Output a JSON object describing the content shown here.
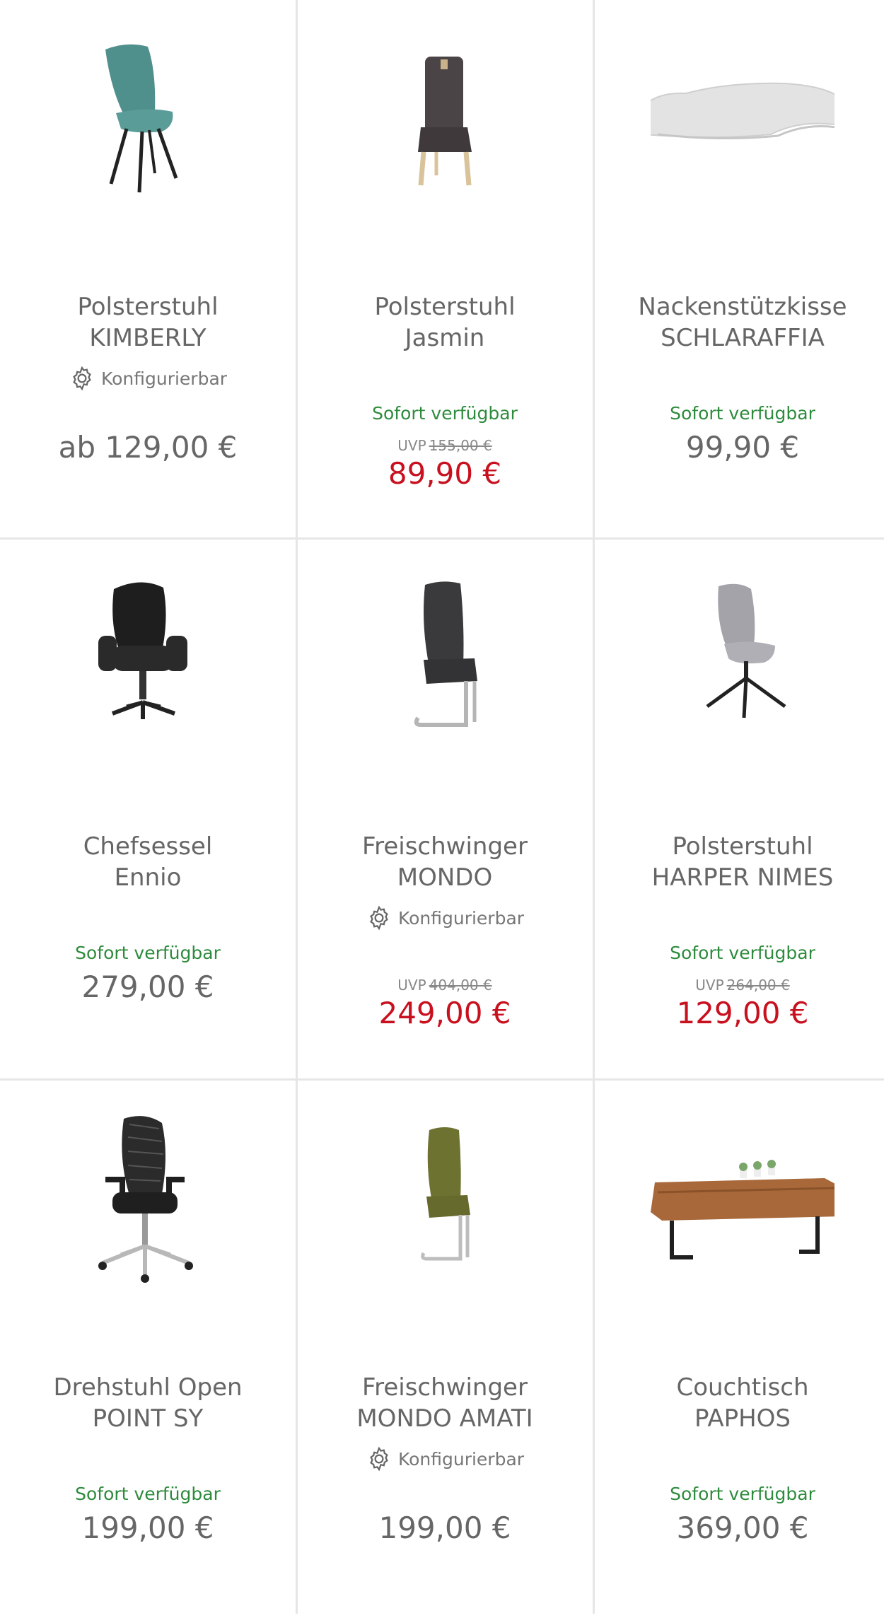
{
  "products": [
    {
      "title_line1": "Polsterstuhl",
      "title_line2": "KIMBERLY",
      "configurable": "Konfigurierbar",
      "availability": "",
      "uvp_label": "",
      "uvp_price": "",
      "price": "ab 129,00 €",
      "sale": false,
      "icon": "teal-upholstered-chair"
    },
    {
      "title_line1": "Polsterstuhl",
      "title_line2": "Jasmin",
      "configurable": "",
      "availability": "Sofort verfügbar",
      "uvp_label": "UVP",
      "uvp_price": "155,00 €",
      "price": "89,90 €",
      "sale": true,
      "icon": "brown-dining-chair"
    },
    {
      "title_line1": "Nackenstützkisse",
      "title_line2": "SCHLARAFFIA",
      "configurable": "",
      "availability": "Sofort verfügbar",
      "uvp_label": "",
      "uvp_price": "",
      "price": "99,90 €",
      "sale": false,
      "icon": "neck-pillow"
    },
    {
      "title_line1": "Chefsessel",
      "title_line2": "Ennio",
      "configurable": "",
      "availability": "Sofort verfügbar",
      "uvp_label": "",
      "uvp_price": "",
      "price": "279,00 €",
      "sale": false,
      "icon": "black-executive-chair"
    },
    {
      "title_line1": "Freischwinger",
      "title_line2": "MONDO",
      "configurable": "Konfigurierbar",
      "availability": "",
      "uvp_label": "UVP",
      "uvp_price": "404,00 €",
      "price": "249,00 €",
      "sale": true,
      "icon": "cantilever-chair-dark"
    },
    {
      "title_line1": "Polsterstuhl",
      "title_line2": "HARPER NIMES",
      "configurable": "",
      "availability": "Sofort verfügbar",
      "uvp_label": "UVP",
      "uvp_price": "264,00 €",
      "price": "129,00 €",
      "sale": true,
      "icon": "grey-swivel-chair"
    },
    {
      "title_line1": "Drehstuhl Open",
      "title_line2": "POINT SY",
      "configurable": "",
      "availability": "Sofort verfügbar",
      "uvp_label": "",
      "uvp_price": "",
      "price": "199,00 €",
      "sale": false,
      "icon": "mesh-office-chair"
    },
    {
      "title_line1": "Freischwinger",
      "title_line2": "MONDO AMATI",
      "configurable": "Konfigurierbar",
      "availability": "",
      "uvp_label": "",
      "uvp_price": "",
      "price": "199,00 €",
      "sale": false,
      "icon": "olive-cantilever-chair"
    },
    {
      "title_line1": "Couchtisch",
      "title_line2": "PAPHOS",
      "configurable": "",
      "availability": "Sofort verfügbar",
      "uvp_label": "",
      "uvp_price": "",
      "price": "369,00 €",
      "sale": false,
      "icon": "wooden-coffee-table"
    }
  ],
  "colors": {
    "availability": "#2e8b3d",
    "sale_price": "#c8101e",
    "regular_price": "#666666"
  }
}
